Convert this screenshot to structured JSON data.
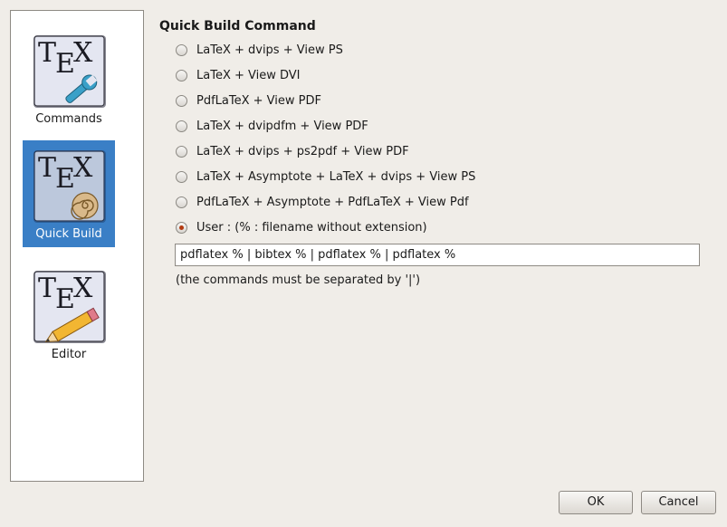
{
  "sidebar": {
    "items": [
      {
        "label": "Commands",
        "icon": "tex-wrench-icon",
        "selected": false
      },
      {
        "label": "Quick Build",
        "icon": "tex-spiral-icon",
        "selected": true
      },
      {
        "label": "Editor",
        "icon": "tex-pencil-icon",
        "selected": false
      }
    ]
  },
  "main": {
    "title": "Quick Build Command",
    "options": [
      {
        "label": "LaTeX + dvips + View PS",
        "checked": false
      },
      {
        "label": "LaTeX + View DVI",
        "checked": false
      },
      {
        "label": "PdfLaTeX + View PDF",
        "checked": false
      },
      {
        "label": "LaTeX + dvipdfm + View PDF",
        "checked": false
      },
      {
        "label": "LaTeX + dvips + ps2pdf + View PDF",
        "checked": false
      },
      {
        "label": "LaTeX + Asymptote + LaTeX + dvips + View PS",
        "checked": false
      },
      {
        "label": "PdfLaTeX + Asymptote + PdfLaTeX + View Pdf",
        "checked": false
      },
      {
        "label": "User : (% : filename without extension)",
        "checked": true
      }
    ],
    "user_command": "pdflatex % | bibtex % | pdflatex % | pdflatex %",
    "hint": "(the commands must be separated by '|')"
  },
  "buttons": {
    "ok": "OK",
    "cancel": "Cancel"
  },
  "colors": {
    "selection": "#3a7fc6",
    "radio_checked": "#b33a10"
  }
}
